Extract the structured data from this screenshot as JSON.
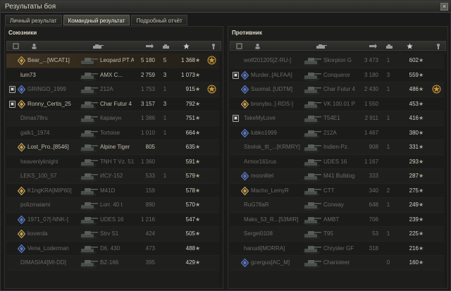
{
  "window": {
    "title": "Результаты боя",
    "close": "×"
  },
  "tabs": [
    {
      "label": "Личный результат",
      "active": false
    },
    {
      "label": "Командный результат",
      "active": true
    },
    {
      "label": "Подробный отчёт",
      "active": false
    }
  ],
  "allies": {
    "title": "Союзники",
    "rows": [
      {
        "name": "Bear_...[WCAT1]",
        "tank": "Leopard PT A",
        "damage": "5 180",
        "kills": "5",
        "xp": "1 368",
        "platoon": false,
        "badge": true,
        "medal": true,
        "highlight": true,
        "dead": false
      },
      {
        "name": "lum73",
        "tank": "AMX C...",
        "damage": "2 759",
        "kills": "3",
        "xp": "1 073",
        "platoon": false,
        "badge": false,
        "medal": false,
        "highlight": false,
        "dead": false
      },
      {
        "name": "GRINGO_1999",
        "tank": "212A",
        "damage": "1 753",
        "kills": "1",
        "xp": "915",
        "platoon": true,
        "badge": true,
        "medal": true,
        "highlight": false,
        "dead": true
      },
      {
        "name": "Ronny_Certis_25",
        "tank": "Char Futur 4",
        "damage": "3 157",
        "kills": "3",
        "xp": "792",
        "platoon": true,
        "badge": true,
        "medal": false,
        "highlight": false,
        "dead": false
      },
      {
        "name": "Dimas78ru",
        "tank": "Каракун",
        "damage": "1 386",
        "kills": "1",
        "xp": "751",
        "platoon": false,
        "badge": false,
        "medal": false,
        "highlight": false,
        "dead": true
      },
      {
        "name": "galk1_1974",
        "tank": "Tortoise",
        "damage": "1 010",
        "kills": "1",
        "xp": "664",
        "platoon": false,
        "badge": false,
        "medal": false,
        "highlight": false,
        "dead": true
      },
      {
        "name": "Lost_Pro..[8546]",
        "tank": "Alpine Tiger",
        "damage": "805",
        "kills": "",
        "xp": "635",
        "platoon": false,
        "badge": true,
        "medal": false,
        "highlight": false,
        "dead": false
      },
      {
        "name": "heavenlyknight",
        "tank": "TNH T Vz. 51",
        "damage": "1 360",
        "kills": "",
        "xp": "591",
        "platoon": false,
        "badge": false,
        "medal": false,
        "highlight": false,
        "dead": true
      },
      {
        "name": "LEKS_100_57",
        "tank": "ИСУ-152",
        "damage": "533",
        "kills": "1",
        "xp": "579",
        "platoon": false,
        "badge": false,
        "medal": false,
        "highlight": false,
        "dead": true
      },
      {
        "name": "K1ngKRA[MIP60]",
        "tank": "M41D",
        "damage": "159",
        "kills": "",
        "xp": "578",
        "platoon": false,
        "badge": true,
        "medal": false,
        "highlight": false,
        "dead": true
      },
      {
        "name": "polizmaiami",
        "tank": "Lorr. 40 t",
        "damage": "890",
        "kills": "",
        "xp": "570",
        "platoon": false,
        "badge": false,
        "medal": false,
        "highlight": false,
        "dead": true
      },
      {
        "name": "1971_07[-NNK-]",
        "tank": "UDES 16",
        "damage": "1 216",
        "kills": "",
        "xp": "547",
        "platoon": false,
        "badge": true,
        "medal": false,
        "highlight": false,
        "dead": true
      },
      {
        "name": "koverda",
        "tank": "Strv S1",
        "damage": "424",
        "kills": "",
        "xp": "505",
        "platoon": false,
        "badge": true,
        "medal": false,
        "highlight": false,
        "dead": true
      },
      {
        "name": "Vena_Loderman",
        "tank": "D6. 430",
        "damage": "473",
        "kills": "",
        "xp": "488",
        "platoon": false,
        "badge": true,
        "medal": false,
        "highlight": false,
        "dead": true
      },
      {
        "name": "DIMASIA4[MI-DD]",
        "tank": "BZ-166",
        "damage": "395",
        "kills": "",
        "xp": "429",
        "platoon": false,
        "badge": false,
        "medal": false,
        "highlight": false,
        "dead": true
      }
    ]
  },
  "enemies": {
    "title": "Противник",
    "rows": [
      {
        "name": "wolf201205[Z-RU-]",
        "tank": "Skorpion G",
        "damage": "3 473",
        "kills": "1",
        "xp": "602",
        "platoon": false,
        "badge": false,
        "medal": false,
        "highlight": false,
        "dead": true
      },
      {
        "name": "Murder..[ALFAA]",
        "tank": "Conqueror",
        "damage": "3 180",
        "kills": "3",
        "xp": "559",
        "platoon": true,
        "badge": true,
        "medal": false,
        "highlight": false,
        "dead": true
      },
      {
        "name": "Suomal..[UDTM]",
        "tank": "Char Futur 4",
        "damage": "2 430",
        "kills": "1",
        "xp": "486",
        "platoon": false,
        "badge": true,
        "medal": true,
        "highlight": false,
        "dead": true
      },
      {
        "name": "bronybo..[-RDS-]",
        "tank": "VK 100.01 P",
        "damage": "1 550",
        "kills": "",
        "xp": "453",
        "platoon": false,
        "badge": true,
        "medal": false,
        "highlight": false,
        "dead": true
      },
      {
        "name": "TakeMyLove",
        "tank": "T54E1",
        "damage": "2 911",
        "kills": "1",
        "xp": "416",
        "platoon": true,
        "badge": false,
        "medal": false,
        "highlight": false,
        "dead": true
      },
      {
        "name": "lubko1999",
        "tank": "212A",
        "damage": "1 467",
        "kills": "",
        "xp": "380",
        "platoon": false,
        "badge": true,
        "medal": false,
        "highlight": false,
        "dead": true
      },
      {
        "name": "Strelok_tlt_...[KRMRY]",
        "tank": "Indien-Pz.",
        "damage": "908",
        "kills": "1",
        "xp": "331",
        "platoon": false,
        "badge": false,
        "medal": false,
        "highlight": false,
        "dead": true
      },
      {
        "name": "Armor161rus",
        "tank": "UDES 16",
        "damage": "1 167",
        "kills": "",
        "xp": "293",
        "platoon": false,
        "badge": false,
        "medal": false,
        "highlight": false,
        "dead": true
      },
      {
        "name": "moonlitel",
        "tank": "M41 Bulldog",
        "damage": "333",
        "kills": "",
        "xp": "287",
        "platoon": false,
        "badge": true,
        "medal": false,
        "highlight": false,
        "dead": true
      },
      {
        "name": "Macho_LemyR",
        "tank": "CTT",
        "damage": "340",
        "kills": "2",
        "xp": "275",
        "platoon": false,
        "badge": true,
        "medal": false,
        "highlight": false,
        "dead": true
      },
      {
        "name": "RuG78aR",
        "tank": "Conway",
        "damage": "648",
        "kills": "1",
        "xp": "249",
        "platoon": false,
        "badge": false,
        "medal": false,
        "highlight": false,
        "dead": true
      },
      {
        "name": "Maks_53_R...[53MIR]",
        "tank": "AMBT",
        "damage": "706",
        "kills": "",
        "xp": "239",
        "platoon": false,
        "badge": false,
        "medal": false,
        "highlight": false,
        "dead": true
      },
      {
        "name": "Sergei0108",
        "tank": "T95",
        "damage": "53",
        "kills": "1",
        "xp": "225",
        "platoon": false,
        "badge": false,
        "medal": false,
        "highlight": false,
        "dead": true
      },
      {
        "name": "hanudi[MORRA]",
        "tank": "Chrysler GF",
        "damage": "318",
        "kills": "",
        "xp": "216",
        "platoon": false,
        "badge": false,
        "medal": false,
        "highlight": false,
        "dead": true
      },
      {
        "name": "gcergus[AC_M]",
        "tank": "Charioteer",
        "damage": "",
        "kills": "0",
        "xp": "160",
        "platoon": false,
        "badge": true,
        "medal": false,
        "highlight": false,
        "dead": true
      }
    ]
  },
  "icons": {
    "star": "★",
    "platoon": "platoon-icon",
    "badge": "rank-badge-icon",
    "medal": "medal-icon"
  },
  "colors": {
    "highlight": "#3e3222",
    "medal": "#c89a3c",
    "badge_blue": "#5a7ac8",
    "badge_gold": "#c8a050"
  }
}
